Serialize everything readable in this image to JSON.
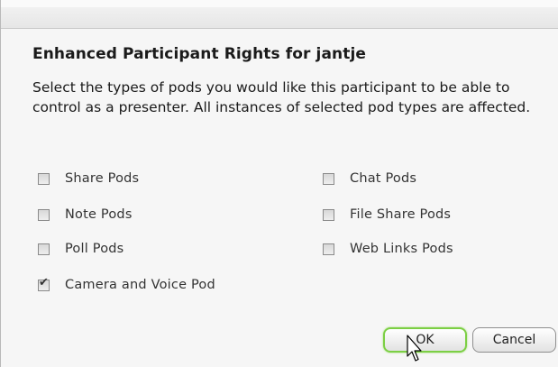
{
  "dialog": {
    "heading": "Enhanced Participant Rights for jantje",
    "description": "Select the types of pods you would like this participant to be able to control as a presenter. All instances of selected pod types are affected."
  },
  "options": [
    {
      "label": "Share Pods",
      "checked": false
    },
    {
      "label": "Chat Pods",
      "checked": false
    },
    {
      "label": "Note Pods",
      "checked": false
    },
    {
      "label": "File Share Pods",
      "checked": false
    },
    {
      "label": "Poll Pods",
      "checked": false
    },
    {
      "label": "Web Links Pods",
      "checked": false
    },
    {
      "label": "Camera and Voice Pod",
      "checked": true
    }
  ],
  "buttons": {
    "ok_label": "OK",
    "cancel_label": "Cancel"
  },
  "colors": {
    "ok_focus_ring": "#7ccf44"
  }
}
